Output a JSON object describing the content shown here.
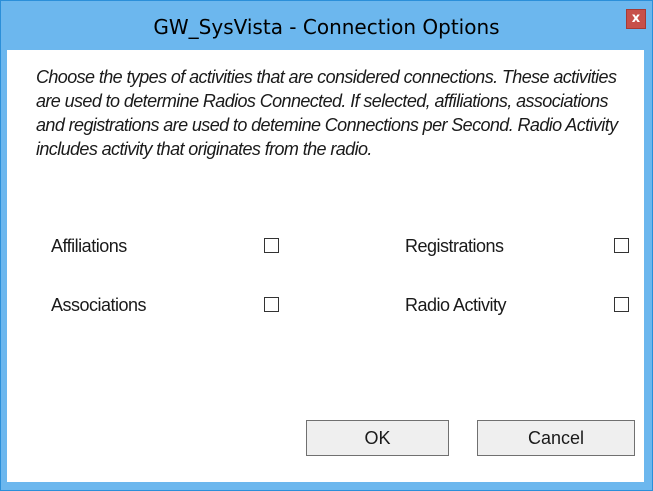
{
  "window": {
    "title": "GW_SysVista - Connection Options",
    "close_label": "x"
  },
  "description": "Choose the types of activities that are considered connections. These activities are used to determine Radios Connected.  If selected, affiliations, associations and registrations are used to detemine Connections per Second. Radio Activity includes activity that originates from the radio.",
  "options": {
    "affiliations": {
      "label": "Affiliations",
      "checked": false
    },
    "associations": {
      "label": "Associations",
      "checked": false
    },
    "registrations": {
      "label": "Registrations",
      "checked": false
    },
    "radio_activity": {
      "label": "Radio Activity",
      "checked": false
    }
  },
  "buttons": {
    "ok_label": "OK",
    "cancel_label": "Cancel"
  },
  "colors": {
    "titlebar": "#6cb7ee",
    "close_button": "#c7504a",
    "button_face": "#efefef"
  }
}
